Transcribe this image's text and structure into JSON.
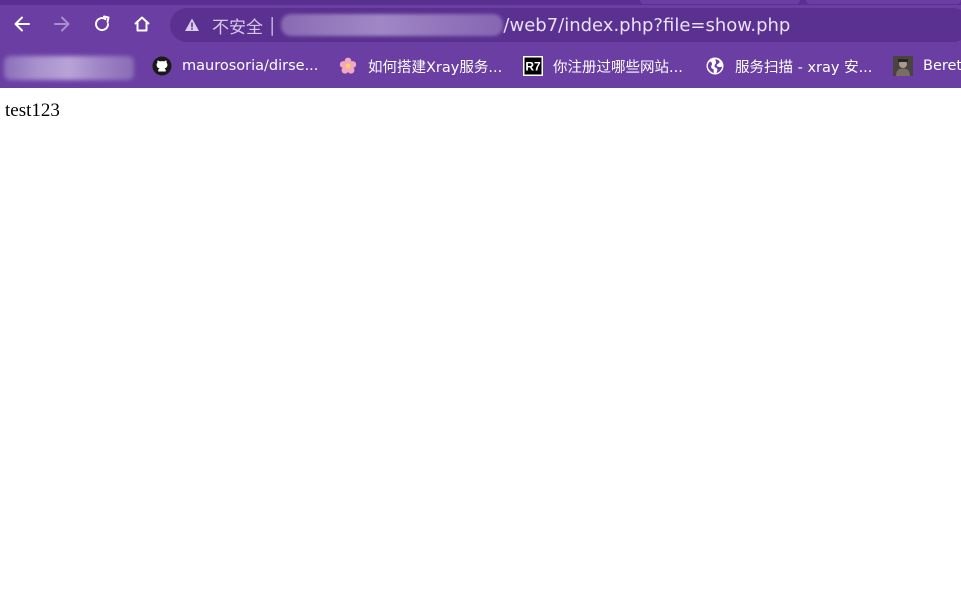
{
  "browser": {
    "theme_color": "#6a3ea3",
    "omnibox_color": "#5a3190",
    "toolbar": {
      "back_icon": "arrow-left-icon",
      "forward_icon": "arrow-right-icon",
      "reload_icon": "reload-icon",
      "home_icon": "home-icon"
    },
    "address_bar": {
      "security_icon": "warning-triangle-icon",
      "security_label": "不安全",
      "separator": "|",
      "url_path": "/web7/index.php?file=show.php"
    },
    "bookmarks": [
      {
        "icon": "github-icon",
        "label": "maurosoria/dirse..."
      },
      {
        "icon": "flower-icon",
        "label": "如何搭建Xray服务..."
      },
      {
        "icon": "r7-logo-icon",
        "icon_text": "R7",
        "label": "你注册过哪些网站..."
      },
      {
        "icon": "globe-icon",
        "label": "服务扫描 - xray 安..."
      },
      {
        "icon": "avatar-icon",
        "label": "Beret"
      }
    ]
  },
  "page": {
    "body_text": "test123"
  }
}
